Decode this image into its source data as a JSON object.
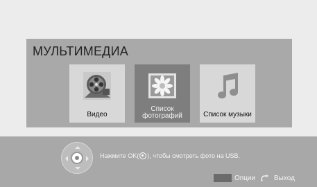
{
  "panel": {
    "title": "МУЛЬТИМЕДИА",
    "items": [
      {
        "label": "Видео",
        "icon": "film-reel-icon",
        "selected": false
      },
      {
        "label_line1": "Список",
        "label_line2": "фотографий",
        "icon": "photo-flower-icon",
        "selected": true
      },
      {
        "label": "Список музыки",
        "icon": "music-note-icon",
        "selected": false
      }
    ]
  },
  "footer": {
    "hint_before": "Нажмите OK(",
    "hint_after": "), чтобы смотреть фото на USB.",
    "options_label": "Опции",
    "exit_label": "Выход"
  },
  "colors": {
    "panel": "#a9a9a9",
    "tile": "#d8d8d8",
    "tile_selected": "#7e7e7e",
    "footer": "#a8a8a8"
  }
}
